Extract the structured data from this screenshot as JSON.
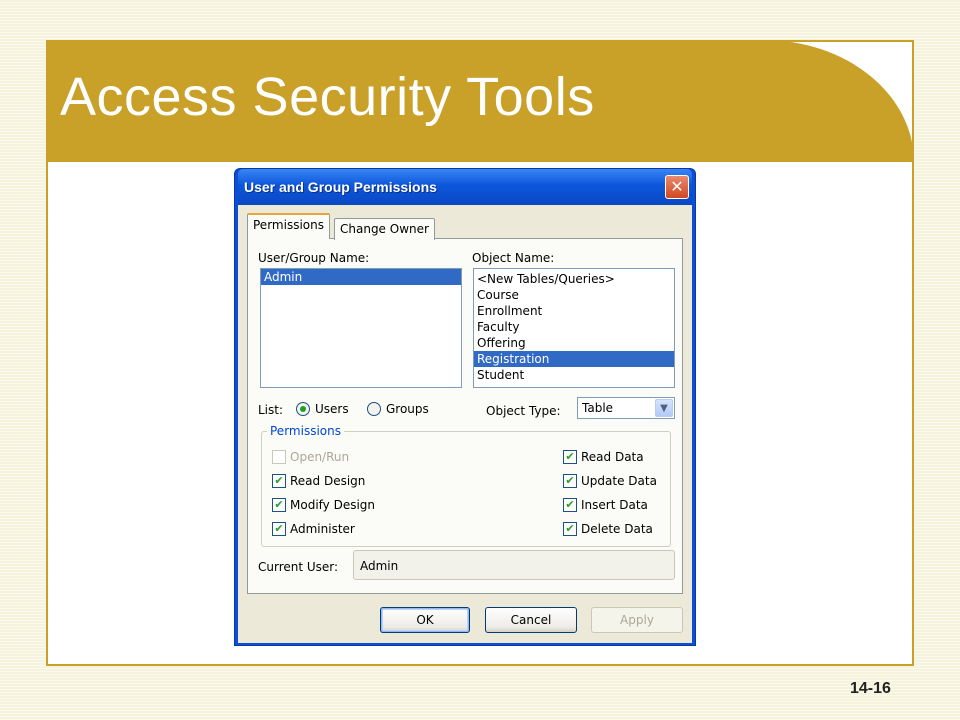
{
  "slide": {
    "title": "Access Security Tools",
    "page_number": "14-16"
  },
  "dialog": {
    "title": "User and Group Permissions",
    "close_glyph": "✕",
    "tabs": [
      {
        "label": "Permissions"
      },
      {
        "label": "Change Owner"
      }
    ],
    "user_group_label": "User/Group Name:",
    "users": [
      "Admin"
    ],
    "object_name_label": "Object Name:",
    "objects": [
      "<New Tables/Queries>",
      "Course",
      "Enrollment",
      "Faculty",
      "Offering",
      "Registration",
      "Student"
    ],
    "list_label": "List:",
    "radio_users": "Users",
    "radio_groups": "Groups",
    "object_type_label": "Object Type:",
    "object_type_value": "Table",
    "dropdown_glyph": "▼",
    "permissions_group_label": "Permissions",
    "check_glyph": "✔",
    "perm_open_run": "Open/Run",
    "perm_read_design": "Read Design",
    "perm_modify_design": "Modify Design",
    "perm_administer": "Administer",
    "perm_read_data": "Read Data",
    "perm_update_data": "Update Data",
    "perm_insert_data": "Insert Data",
    "perm_delete_data": "Delete Data",
    "current_user_label": "Current User:",
    "current_user_value": "Admin",
    "ok_label": "OK",
    "cancel_label": "Cancel",
    "apply_label": "Apply"
  }
}
